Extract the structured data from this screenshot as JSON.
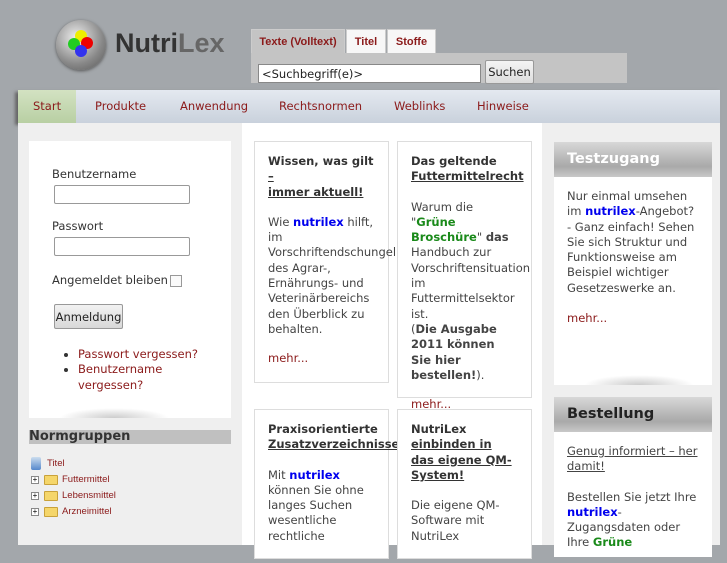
{
  "brand": {
    "part1": "Nutri",
    "part2": "Lex"
  },
  "search": {
    "tabs": [
      "Texte (Volltext)",
      "Titel",
      "Stoffe"
    ],
    "value": "<Suchbegriff(e)>",
    "button": "Suchen"
  },
  "nav": [
    "Start",
    "Produkte",
    "Anwendung",
    "Rechtsnormen",
    "Weblinks",
    "Hinweise"
  ],
  "login": {
    "username_label": "Benutzername",
    "password_label": "Passwort",
    "remember_label": "Angemeldet bleiben",
    "button": "Anmeldung",
    "links": [
      "Passwort vergessen?",
      "Benutzername vergessen?"
    ]
  },
  "normgruppen": {
    "title": "Normgruppen",
    "root": "Titel",
    "items": [
      "Futtermittel",
      "Lebensmittel",
      "Arzneimittel"
    ]
  },
  "cards": [
    {
      "title1": "Wissen, was gilt",
      "title2": "–",
      "title3": "immer aktuell!",
      "pre": "Wie ",
      "brand": "nutrilex",
      "post": " hilft, im Vorschriftendschungel des Agrar-, Ernährungs- und Veterinärbereichs den Überblick zu behalten.",
      "more": "mehr..."
    },
    {
      "title1": "Das geltende",
      "title2": "Futtermittelrecht",
      "pre": "Warum die \"",
      "green": "Grüne Broschüre",
      "mid": "\" ",
      "bold1": "das",
      "post": " Handbuch zur Vorschriftensituation im Futtermittelsektor ist.",
      "bold2": "Die Ausgabe 2011 können Sie hier bestellen!",
      "end": ").",
      "open": "(",
      "more": "mehr..."
    },
    {
      "title1": "Praxisorientierte",
      "title2": "Zusatzverzeichnisse",
      "pre": "Mit ",
      "brand": "nutrilex",
      "post": " können Sie ohne langes Suchen wesentliche rechtliche"
    },
    {
      "title1": "NutriLex",
      "title2": "einbinden in das eigene QM-System!",
      "post": "Die eigene QM-Software mit NutriLex"
    }
  ],
  "testzugang": {
    "title": "Testzugang",
    "pre": "Nur einmal umsehen im ",
    "brand": "nutrilex",
    "post": "-Angebot? - Ganz einfach! Sehen Sie sich Struktur und Funktionsweise am Beispiel wichtiger Gesetzeswerke an.",
    "more": "mehr..."
  },
  "bestellung": {
    "title": "Bestellung",
    "link": "Genug informiert – her damit!",
    "pre": "Bestellen Sie jetzt Ihre ",
    "brand": "nutrilex",
    "post": "-Zugangsdaten oder Ihre ",
    "green": "Grüne"
  }
}
